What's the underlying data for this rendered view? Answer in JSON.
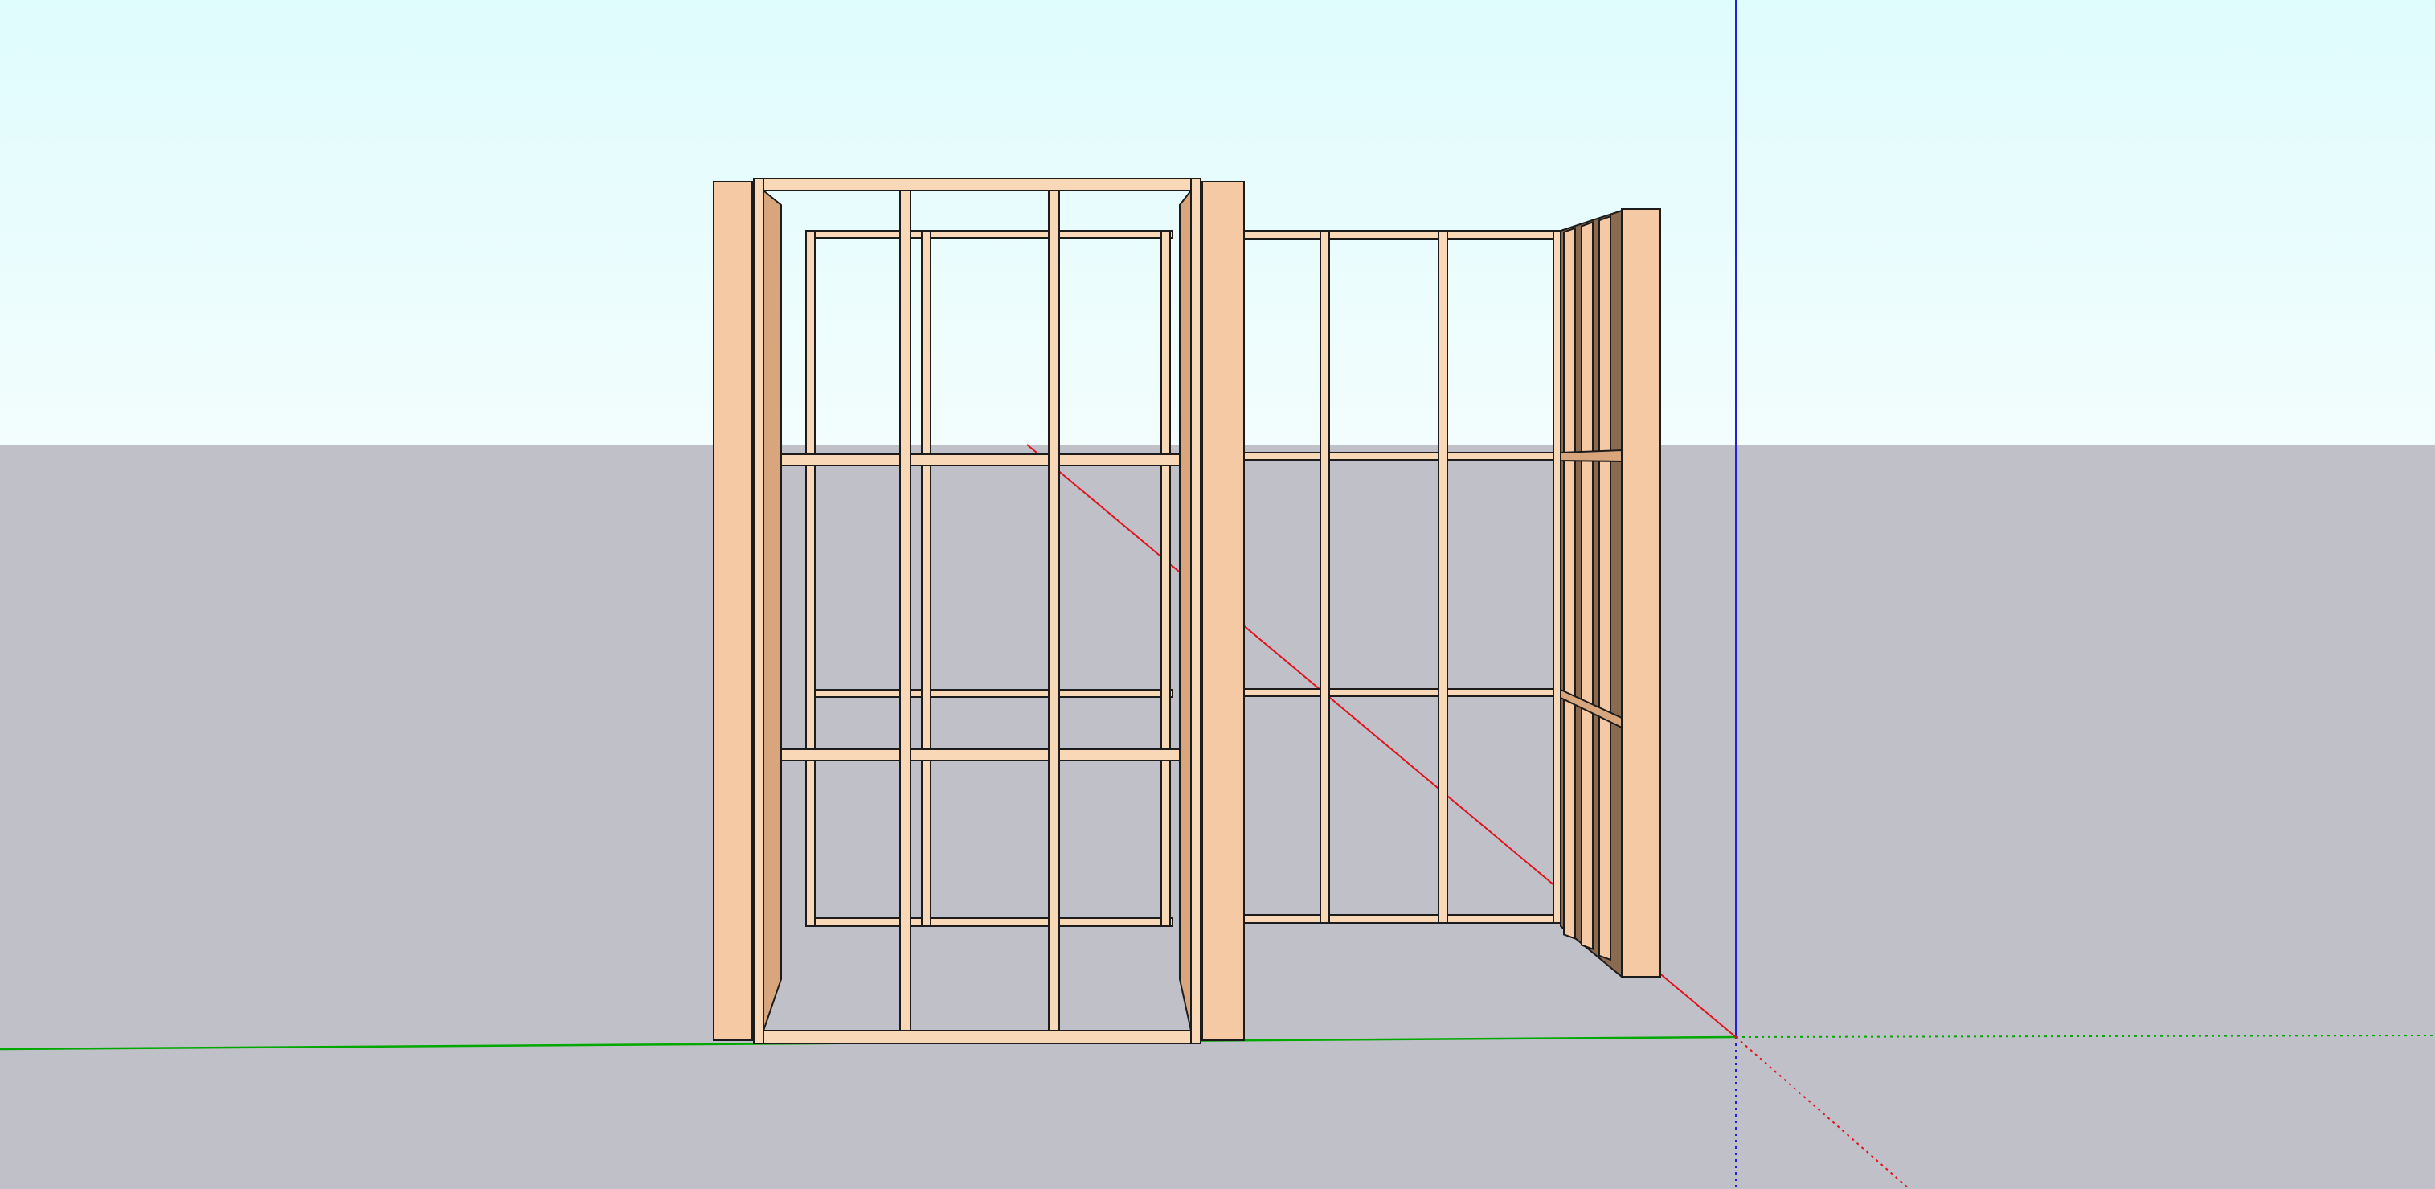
{
  "scene": {
    "view": "perspective",
    "colors": {
      "sky_top": "#dffcfd",
      "sky_bottom": "#f2fdfd",
      "ground": "#c0c0c8",
      "wood_face": "#f4c9a4",
      "wood_face_light": "#f9d8b8",
      "wood_side": "#d8a57c",
      "wood_dark": "#8a6a50",
      "edge": "#1c1c1c",
      "axis_red": "#e0141e",
      "axis_green": "#00b000",
      "axis_blue": "#2020e0"
    },
    "axes": [
      {
        "name": "red-axis",
        "visible": true
      },
      {
        "name": "green-axis",
        "visible": true
      },
      {
        "name": "blue-axis",
        "visible": true
      }
    ],
    "objects": [
      {
        "name": "front-wall-frame",
        "material": "wood"
      },
      {
        "name": "back-wall-frame",
        "material": "wood"
      },
      {
        "name": "side-wall-frame",
        "material": "wood"
      }
    ]
  }
}
